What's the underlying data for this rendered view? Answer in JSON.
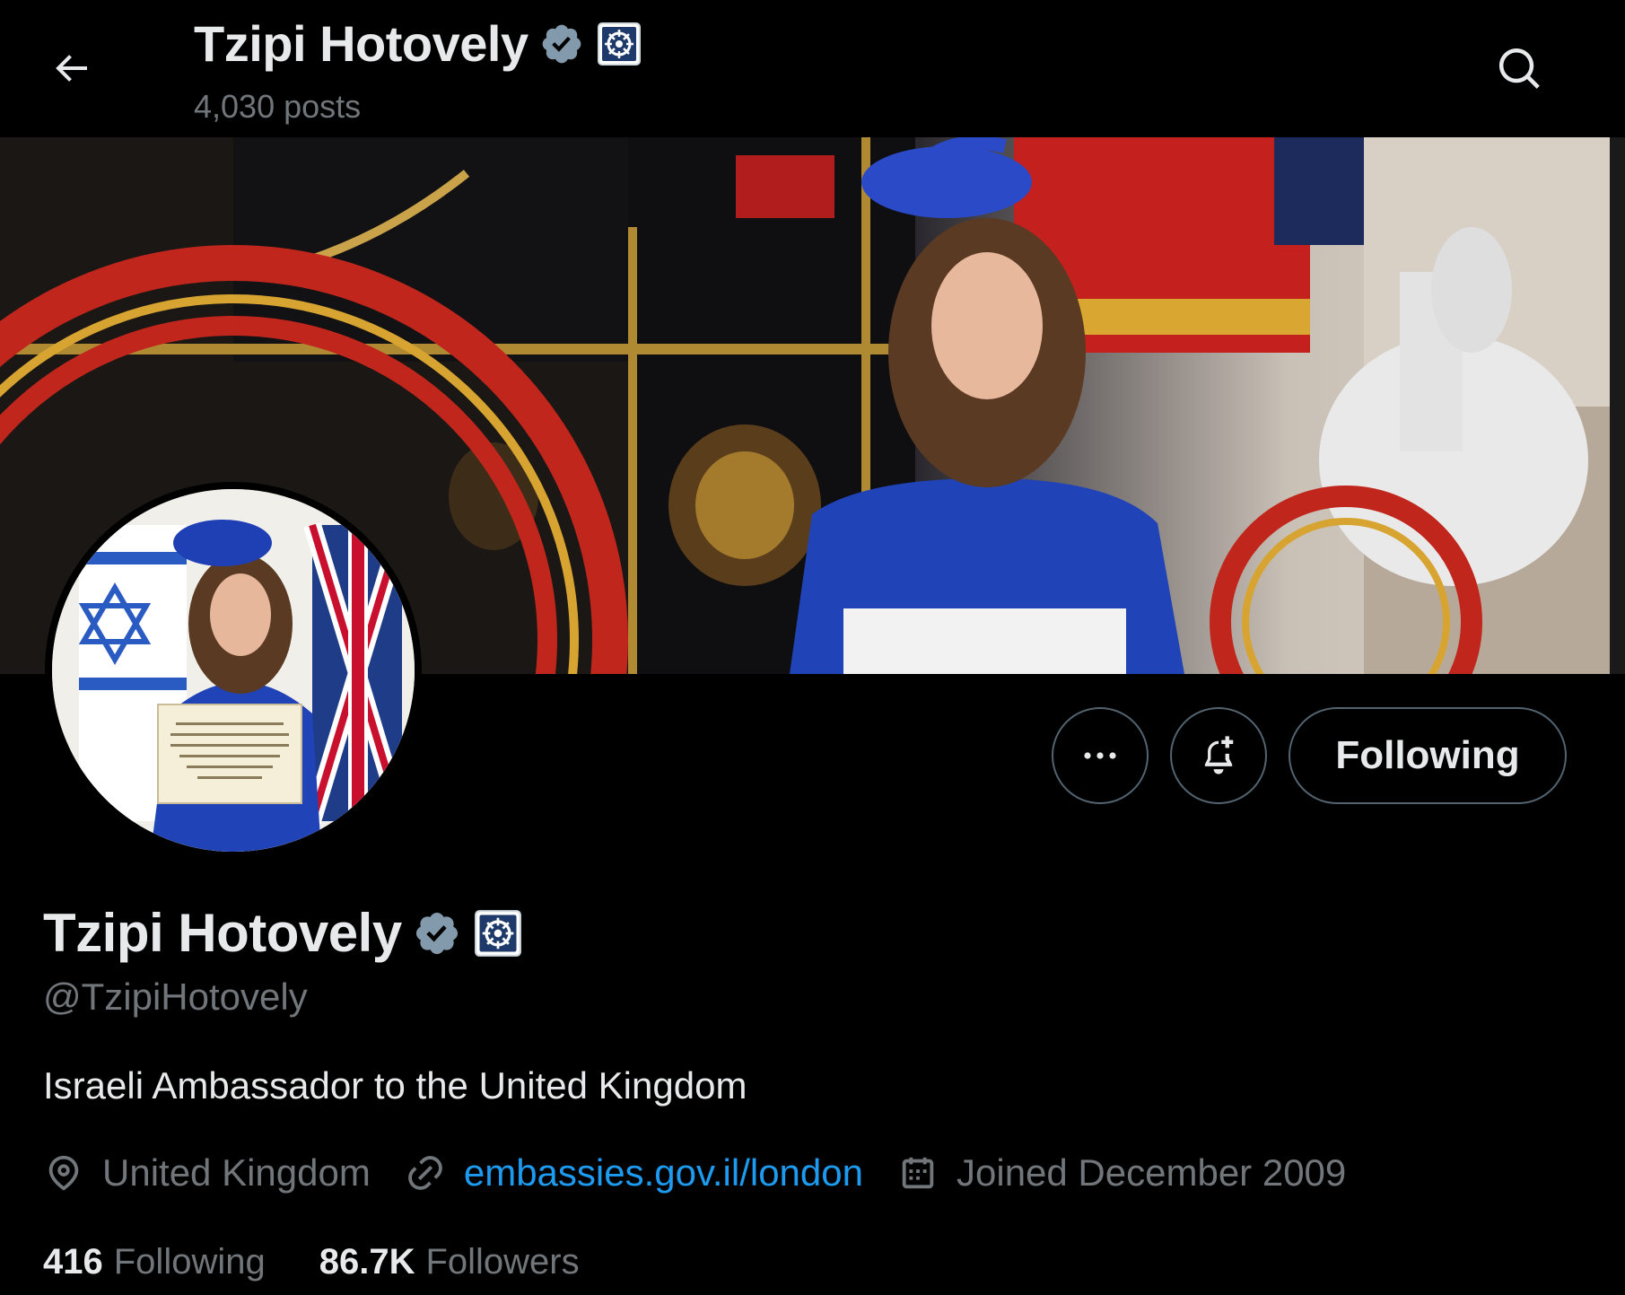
{
  "header": {
    "name": "Tzipi Hotovely",
    "posts": "4,030 posts"
  },
  "profile": {
    "name": "Tzipi Hotovely",
    "handle": "@TzipiHotovely",
    "bio": "Israeli Ambassador to the United Kingdom",
    "location": "United Kingdom",
    "website": "embassies.gov.il/london",
    "joined": "Joined December 2009"
  },
  "actions": {
    "following_label": "Following"
  },
  "stats": {
    "following_count": "416",
    "following_label": "Following",
    "followers_count": "86.7K",
    "followers_label": "Followers"
  },
  "colors": {
    "background": "#000000",
    "text_primary": "#e7e9ea",
    "text_secondary": "#71767b",
    "link": "#1d9bf0",
    "border": "#536471",
    "verified_badge": "#829aab"
  },
  "icons": {
    "back": "arrow-left-icon",
    "search": "search-icon",
    "verified": "verified-badge-icon",
    "affiliation": "affiliation-badge-icon",
    "more": "more-horizontal-icon",
    "notify": "bell-plus-icon",
    "location": "location-pin-icon",
    "link": "link-icon",
    "calendar": "calendar-icon"
  }
}
